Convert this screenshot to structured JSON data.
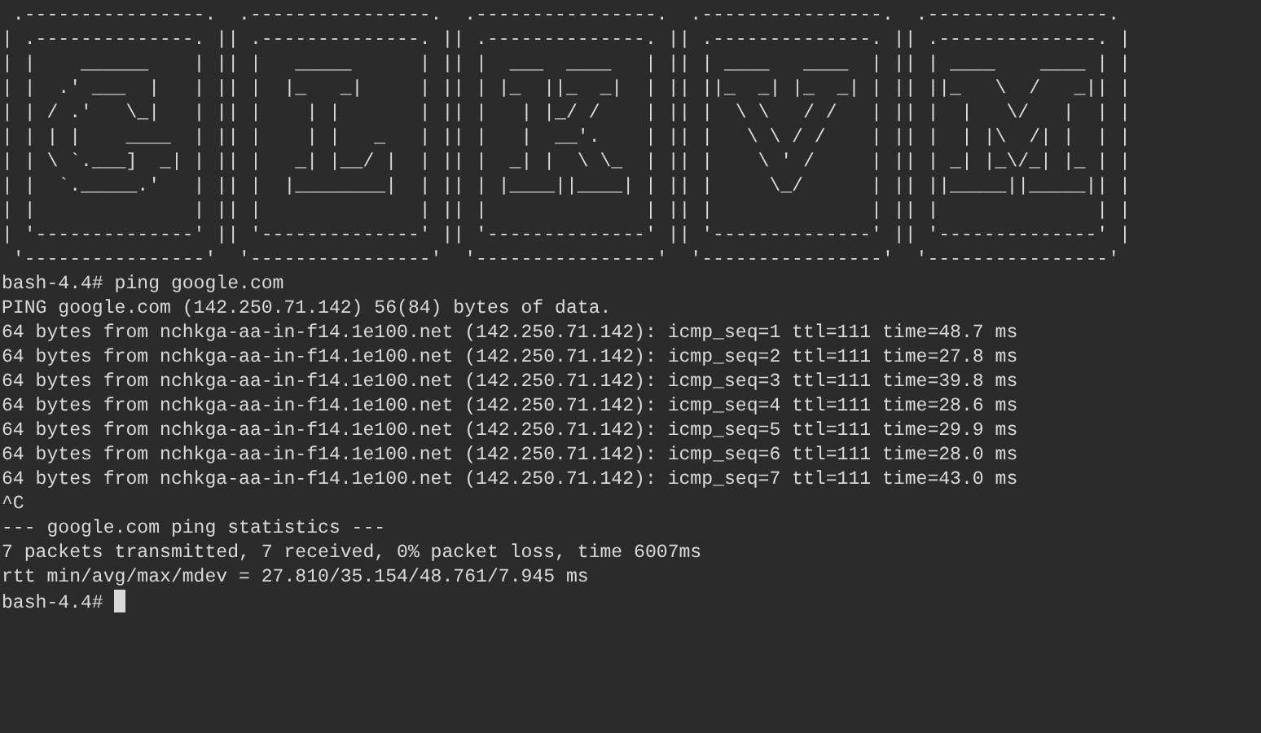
{
  "banner": [
    " .----------------.  .----------------.  .----------------.  .----------------.  .----------------. ",
    "| .--------------. || .--------------. || .--------------. || .--------------. || .--------------. |",
    "| |    ______    | || |   _____      | || |  ___  ____   | || | ____   ____  | || | ____    ____ | |",
    "| |  .' ___  |   | || |  |_   _|     | || | |_  ||_  _|  | || ||_  _| |_  _| | || ||_   \\  /   _|| |",
    "| | / .'   \\_|   | || |    | |       | || |   | |_/ /    | || |  \\ \\   / /   | || |  |   \\/   |  | |",
    "| | | |    ____  | || |    | |   _   | || |   |  __'.    | || |   \\ \\ / /    | || |  | |\\  /| |  | |",
    "| | \\ `.___]  _| | || |   _| |__/ |  | || |  _| |  \\ \\_  | || |    \\ ' /     | || | _| |_\\/_| |_ | |",
    "| |  `._____.'   | || |  |________|  | || | |____||____| | || |     \\_/      | || ||_____||_____|| |",
    "| |              | || |              | || |              | || |              | || |              | |",
    "| '--------------' || '--------------' || '--------------' || '--------------' || '--------------' |",
    " '----------------'  '----------------'  '----------------'  '----------------'  '----------------' "
  ],
  "output": [
    "bash-4.4# ping google.com",
    "PING google.com (142.250.71.142) 56(84) bytes of data.",
    "64 bytes from nchkga-aa-in-f14.1e100.net (142.250.71.142): icmp_seq=1 ttl=111 time=48.7 ms",
    "64 bytes from nchkga-aa-in-f14.1e100.net (142.250.71.142): icmp_seq=2 ttl=111 time=27.8 ms",
    "64 bytes from nchkga-aa-in-f14.1e100.net (142.250.71.142): icmp_seq=3 ttl=111 time=39.8 ms",
    "64 bytes from nchkga-aa-in-f14.1e100.net (142.250.71.142): icmp_seq=4 ttl=111 time=28.6 ms",
    "64 bytes from nchkga-aa-in-f14.1e100.net (142.250.71.142): icmp_seq=5 ttl=111 time=29.9 ms",
    "64 bytes from nchkga-aa-in-f14.1e100.net (142.250.71.142): icmp_seq=6 ttl=111 time=28.0 ms",
    "64 bytes from nchkga-aa-in-f14.1e100.net (142.250.71.142): icmp_seq=7 ttl=111 time=43.0 ms",
    "^C",
    "--- google.com ping statistics ---",
    "7 packets transmitted, 7 received, 0% packet loss, time 6007ms",
    "rtt min/avg/max/mdev = 27.810/35.154/48.761/7.945 ms"
  ],
  "prompt": "bash-4.4#"
}
